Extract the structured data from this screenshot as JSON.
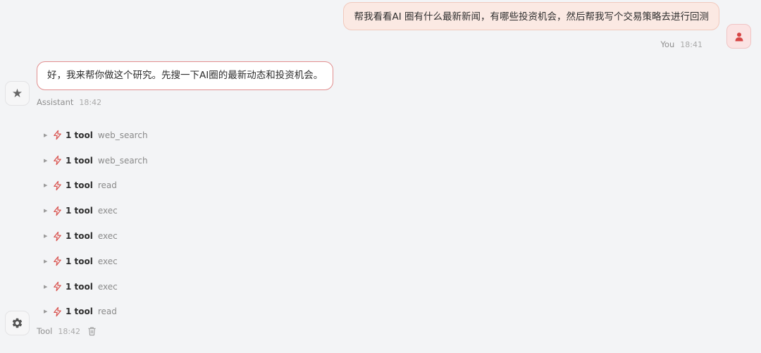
{
  "user_message": {
    "text": "帮我看看AI 圈有什么最新新闻，有哪些投资机会，然后帮我写个交易策略去进行回测",
    "author": "You",
    "time": "18:41",
    "avatar_icon": "user-icon"
  },
  "assistant_message": {
    "text": "好，我来帮你做这个研究。先搜一下AI圈的最新动态和投资机会。",
    "author": "Assistant",
    "time": "18:42",
    "avatar_icon": "star-icon"
  },
  "tool_calls": [
    {
      "count": "1 tool",
      "name": "web_search"
    },
    {
      "count": "1 tool",
      "name": "web_search"
    },
    {
      "count": "1 tool",
      "name": "read"
    },
    {
      "count": "1 tool",
      "name": "exec"
    },
    {
      "count": "1 tool",
      "name": "exec"
    },
    {
      "count": "1 tool",
      "name": "exec"
    },
    {
      "count": "1 tool",
      "name": "exec"
    },
    {
      "count": "1 tool",
      "name": "read"
    }
  ],
  "tool_message": {
    "author": "Tool",
    "time": "18:42",
    "avatar_icon": "gear-icon",
    "action_icon": "trash-icon"
  },
  "colors": {
    "background": "#f3f4f6",
    "user_bubble": "#fbe9e3",
    "assistant_border": "#e18e8e",
    "accent": "#d9534f"
  }
}
